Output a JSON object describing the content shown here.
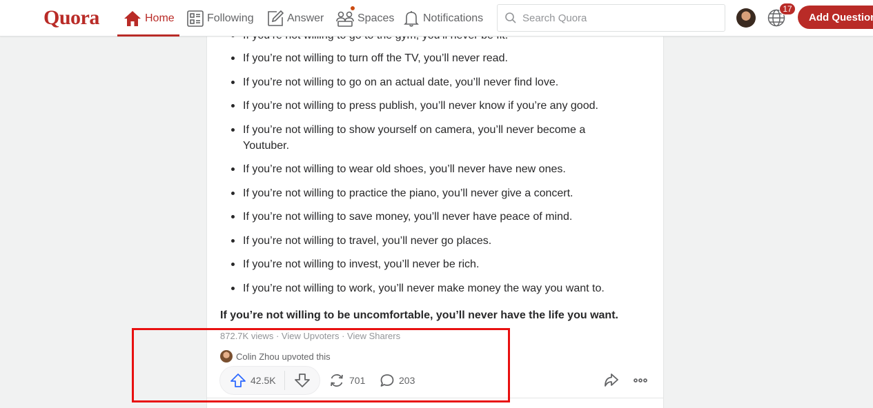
{
  "nav": {
    "logo": "Quora",
    "home": "Home",
    "following": "Following",
    "answer": "Answer",
    "spaces": "Spaces",
    "notifications": "Notifications",
    "search_placeholder": "Search Quora",
    "notification_count": "17",
    "add_question": "Add Question",
    "accent_color": "#b92b27"
  },
  "answer": {
    "partial_top": "If you’re not willing to go to the gym, you’ll never be fit.",
    "bullets": [
      "If you’re not willing to turn off the TV, you’ll never read.",
      "If you’re not willing to go on an actual date, you’ll never find love.",
      "If you’re not willing to press publish, you’ll never know if you’re any good.",
      "If you’re not willing to show yourself on camera, you’ll never become a Youtuber.",
      "If you’re not willing to wear old shoes, you’ll never have new ones.",
      "If you’re not willing to practice the piano, you’ll never give a concert.",
      "If you’re not willing to save money, you’ll never have peace of mind.",
      "If you’re not willing to travel, you’ll never go places.",
      "If you’re not willing to invest, you’ll never be rich.",
      "If you’re not willing to work, you’ll never make money the way you want to."
    ],
    "conclusion": "If you’re not willing to be uncomfortable, you’ll never have the life you want.",
    "views": "872.7K views",
    "separator": " · ",
    "view_upvoters": "View Upvoters",
    "view_sharers": "View Sharers",
    "upvoted_by": "Colin Zhou upvoted this",
    "upvotes": "42.5K",
    "shares": "701",
    "comments": "203"
  }
}
